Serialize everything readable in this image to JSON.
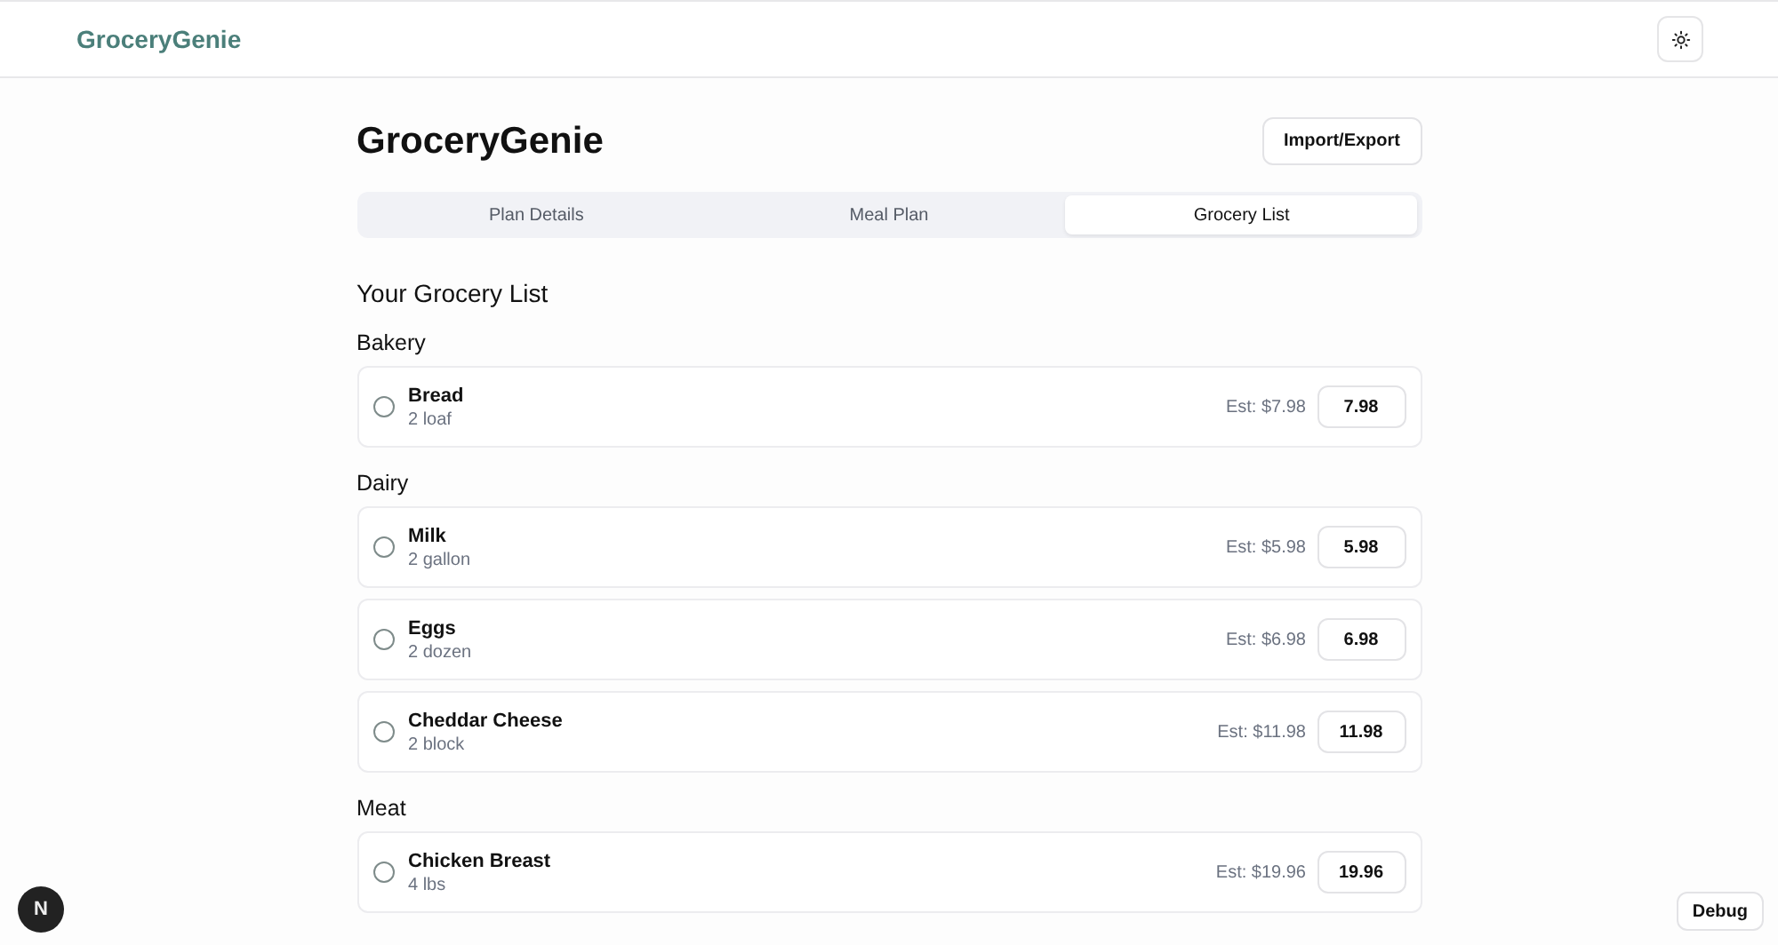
{
  "header": {
    "brand": "GroceryGenie"
  },
  "page": {
    "title": "GroceryGenie",
    "action": "Import/Export"
  },
  "tabs": [
    {
      "label": "Plan Details",
      "selected": false
    },
    {
      "label": "Meal Plan",
      "selected": false
    },
    {
      "label": "Grocery List",
      "selected": true
    }
  ],
  "list_title": "Your Grocery List",
  "categories": [
    {
      "name": "Bakery",
      "items": [
        {
          "name": "Bread",
          "quantity": "2 loaf",
          "estimate": "Est: $7.98",
          "price": "7.98",
          "checked": false
        }
      ]
    },
    {
      "name": "Dairy",
      "items": [
        {
          "name": "Milk",
          "quantity": "2 gallon",
          "estimate": "Est: $5.98",
          "price": "5.98",
          "checked": false
        },
        {
          "name": "Eggs",
          "quantity": "2 dozen",
          "estimate": "Est: $6.98",
          "price": "6.98",
          "checked": false
        },
        {
          "name": "Cheddar Cheese",
          "quantity": "2 block",
          "estimate": "Est: $11.98",
          "price": "11.98",
          "checked": false
        }
      ]
    },
    {
      "name": "Meat",
      "items": [
        {
          "name": "Chicken Breast",
          "quantity": "4 lbs",
          "estimate": "Est: $19.96",
          "price": "19.96",
          "checked": false
        }
      ]
    }
  ],
  "dev_badge": "N",
  "debug_button": "Debug"
}
